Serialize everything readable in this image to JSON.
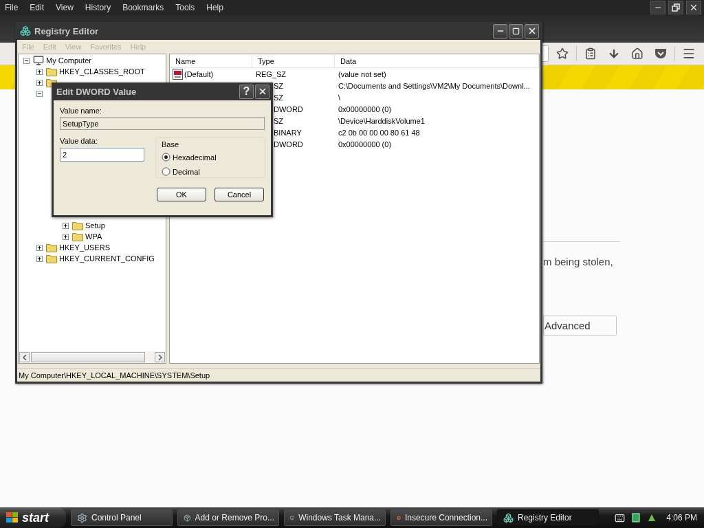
{
  "browser": {
    "menu": [
      "File",
      "Edit",
      "View",
      "History",
      "Bookmarks",
      "Tools",
      "Help"
    ],
    "content": {
      "text": "m being stolen,",
      "button": "Advanced"
    }
  },
  "registry_editor": {
    "title": "Registry Editor",
    "menu": [
      {
        "label": "File",
        "disabled": true
      },
      {
        "label": "Edit",
        "disabled": true
      },
      {
        "label": "View",
        "disabled": true
      },
      {
        "label": "Favorites",
        "disabled": true
      },
      {
        "label": "Help",
        "disabled": true
      }
    ],
    "tree": {
      "label": "My Computer",
      "expanded": true,
      "children": [
        {
          "label": "HKEY_CLASSES_ROOT",
          "expanded": false
        },
        {
          "expanded": false
        },
        {
          "expanded": true,
          "children": [
            {
              "children": [
                {
                  "label": "Setup",
                  "expanded": false
                },
                {
                  "label": "WPA",
                  "expanded": false
                }
              ]
            }
          ]
        },
        {
          "label": "HKEY_USERS",
          "expanded": false
        },
        {
          "label": "HKEY_CURRENT_CONFIG",
          "expanded": false
        }
      ]
    },
    "columns": [
      "Name",
      "Type",
      "Data"
    ],
    "values": [
      {
        "name": "(Default)",
        "type": "REG_SZ",
        "data": "(value not set)"
      },
      {
        "type": "SZ",
        "data": "C:\\Documents and Settings\\VM2\\My Documents\\Downl..."
      },
      {
        "type": "SZ",
        "data": "\\"
      },
      {
        "type": "DWORD",
        "data": "0x00000000 (0)"
      },
      {
        "type": "SZ",
        "data": "\\Device\\HarddiskVolume1"
      },
      {
        "type": "BINARY",
        "data": "c2 0b 00 00 00 80 61 48"
      },
      {
        "type": "DWORD",
        "data": "0x00000000 (0)"
      }
    ],
    "status_bar": "My Computer\\HKEY_LOCAL_MACHINE\\SYSTEM\\Setup"
  },
  "dialog": {
    "title": "Edit DWORD Value",
    "help_button": "?",
    "value_name_label": "Value name:",
    "value_name": "SetupType",
    "value_data_label": "Value data:",
    "value_data": "2",
    "base_label": "Base",
    "bases": [
      {
        "label": "Hexadecimal",
        "selected": true
      },
      {
        "label": "Decimal",
        "selected": false
      }
    ],
    "buttons": [
      "OK",
      "Cancel"
    ]
  },
  "taskbar": {
    "start": "start",
    "items": [
      {
        "label": "Control Panel",
        "selected": false
      },
      {
        "label": "Add or Remove Pro...",
        "selected": false
      },
      {
        "label": "Windows Task Mana...",
        "selected": false
      },
      {
        "label": "Insecure Connection...",
        "selected": false
      },
      {
        "label": "Registry Editor",
        "selected": true
      }
    ],
    "clock": "4:06 PM"
  }
}
